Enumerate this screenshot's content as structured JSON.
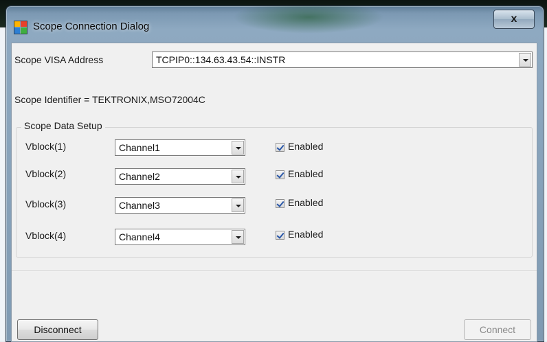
{
  "window": {
    "title": "Scope Connection Dialog",
    "close_label": "x"
  },
  "address": {
    "label": "Scope VISA Address",
    "value": "TCPIP0::134.63.43.54::INSTR"
  },
  "identifier_text": "Scope Identifier = TEKTRONIX,MSO72004C",
  "data_setup": {
    "title": "Scope Data Setup",
    "rows": [
      {
        "label": "Vblock(1)",
        "channel": "Channel1",
        "enabled_label": "Enabled",
        "enabled": true
      },
      {
        "label": "Vblock(2)",
        "channel": "Channel2",
        "enabled_label": "Enabled",
        "enabled": true
      },
      {
        "label": "Vblock(3)",
        "channel": "Channel3",
        "enabled_label": "Enabled",
        "enabled": true
      },
      {
        "label": "Vblock(4)",
        "channel": "Channel4",
        "enabled_label": "Enabled",
        "enabled": true
      }
    ]
  },
  "buttons": {
    "disconnect": "Disconnect",
    "connect": "Connect"
  }
}
